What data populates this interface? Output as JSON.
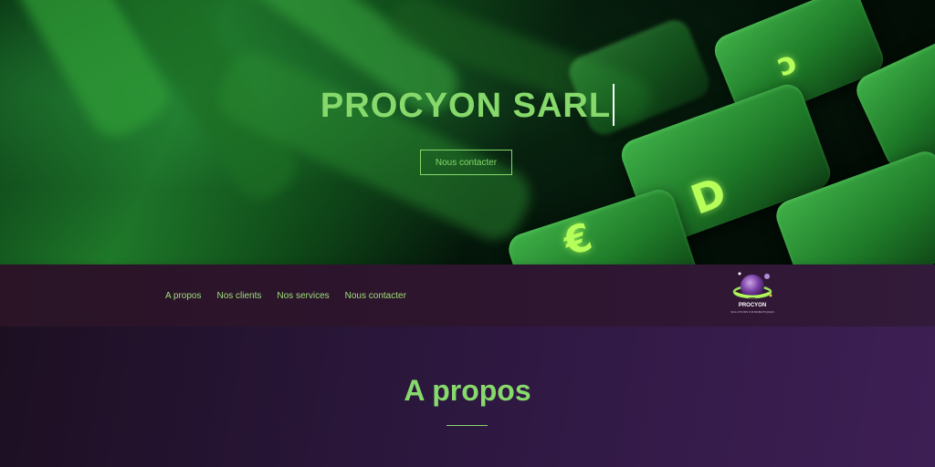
{
  "hero": {
    "title": "PROCYON SARL",
    "contact_button": "Nous contacter",
    "key_glyphs": [
      "ↄ",
      "D",
      "€"
    ]
  },
  "nav": {
    "links": [
      "A propos",
      "Nos clients",
      "Nos services",
      "Nous contacter"
    ],
    "logo_text": "PROCYON",
    "logo_subtitle": "SOLUTIONS INFORMATIQUES"
  },
  "about": {
    "title": "A propos"
  },
  "colors": {
    "accent_green": "#86d96a",
    "nav_bg": "#2e1530",
    "section_bg": "#3e1f55"
  }
}
